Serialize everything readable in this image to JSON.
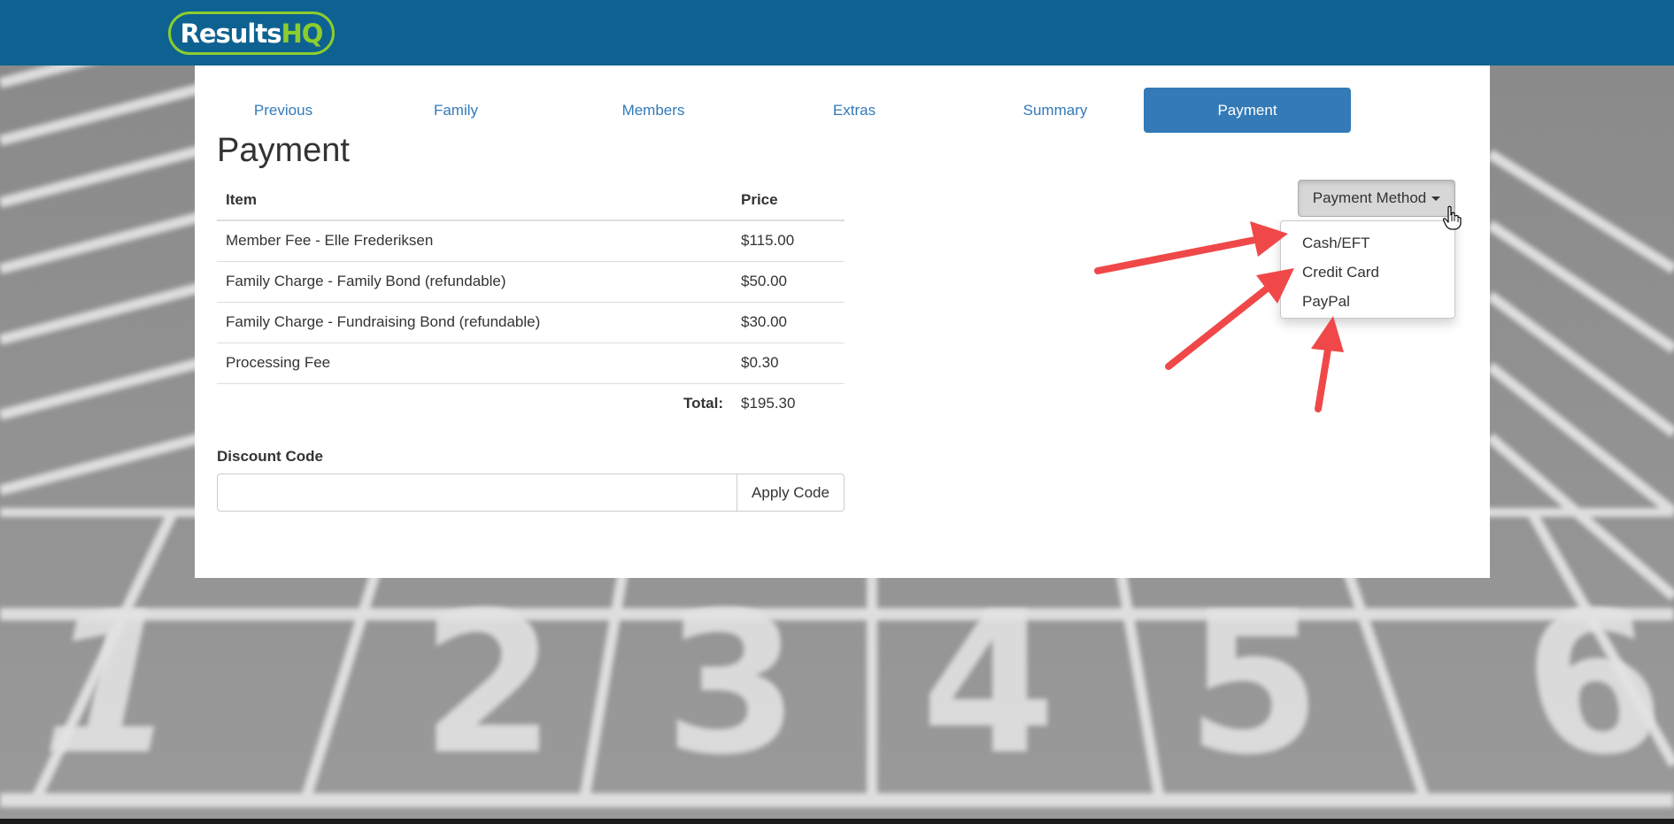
{
  "app": {
    "logo_text_1": "Results",
    "logo_text_2": "HQ",
    "brand_color": "#0e6291",
    "logo_accent": "#8ccd2e"
  },
  "nav": {
    "previous": "Previous",
    "family": "Family",
    "members": "Members",
    "extras": "Extras",
    "summary": "Summary",
    "payment": "Payment",
    "active_tab": "Payment",
    "accent_color": "#337ab7"
  },
  "page": {
    "title": "Payment"
  },
  "table": {
    "headers": {
      "item": "Item",
      "price": "Price"
    },
    "rows": [
      {
        "item": "Member Fee - Elle Frederiksen",
        "price": "$115.00"
      },
      {
        "item": "Family Charge - Family Bond (refundable)",
        "price": "$50.00"
      },
      {
        "item": "Family Charge - Fundraising Bond (refundable)",
        "price": "$30.00"
      },
      {
        "item": "Processing Fee",
        "price": "$0.30"
      }
    ],
    "total_label": "Total:",
    "total_value": "$195.30"
  },
  "discount": {
    "label": "Discount Code",
    "value": "",
    "apply_label": "Apply Code"
  },
  "payment_method": {
    "button_label": "Payment Method",
    "options": [
      "Cash/EFT",
      "Credit Card",
      "PayPal"
    ],
    "expanded": true
  },
  "annotations": {
    "arrow_color": "#f04848",
    "arrow_count": 3
  },
  "icons": {
    "caret": "caret-down-icon",
    "cursor": "hand-pointer-icon",
    "arrow": "arrow-icon"
  }
}
